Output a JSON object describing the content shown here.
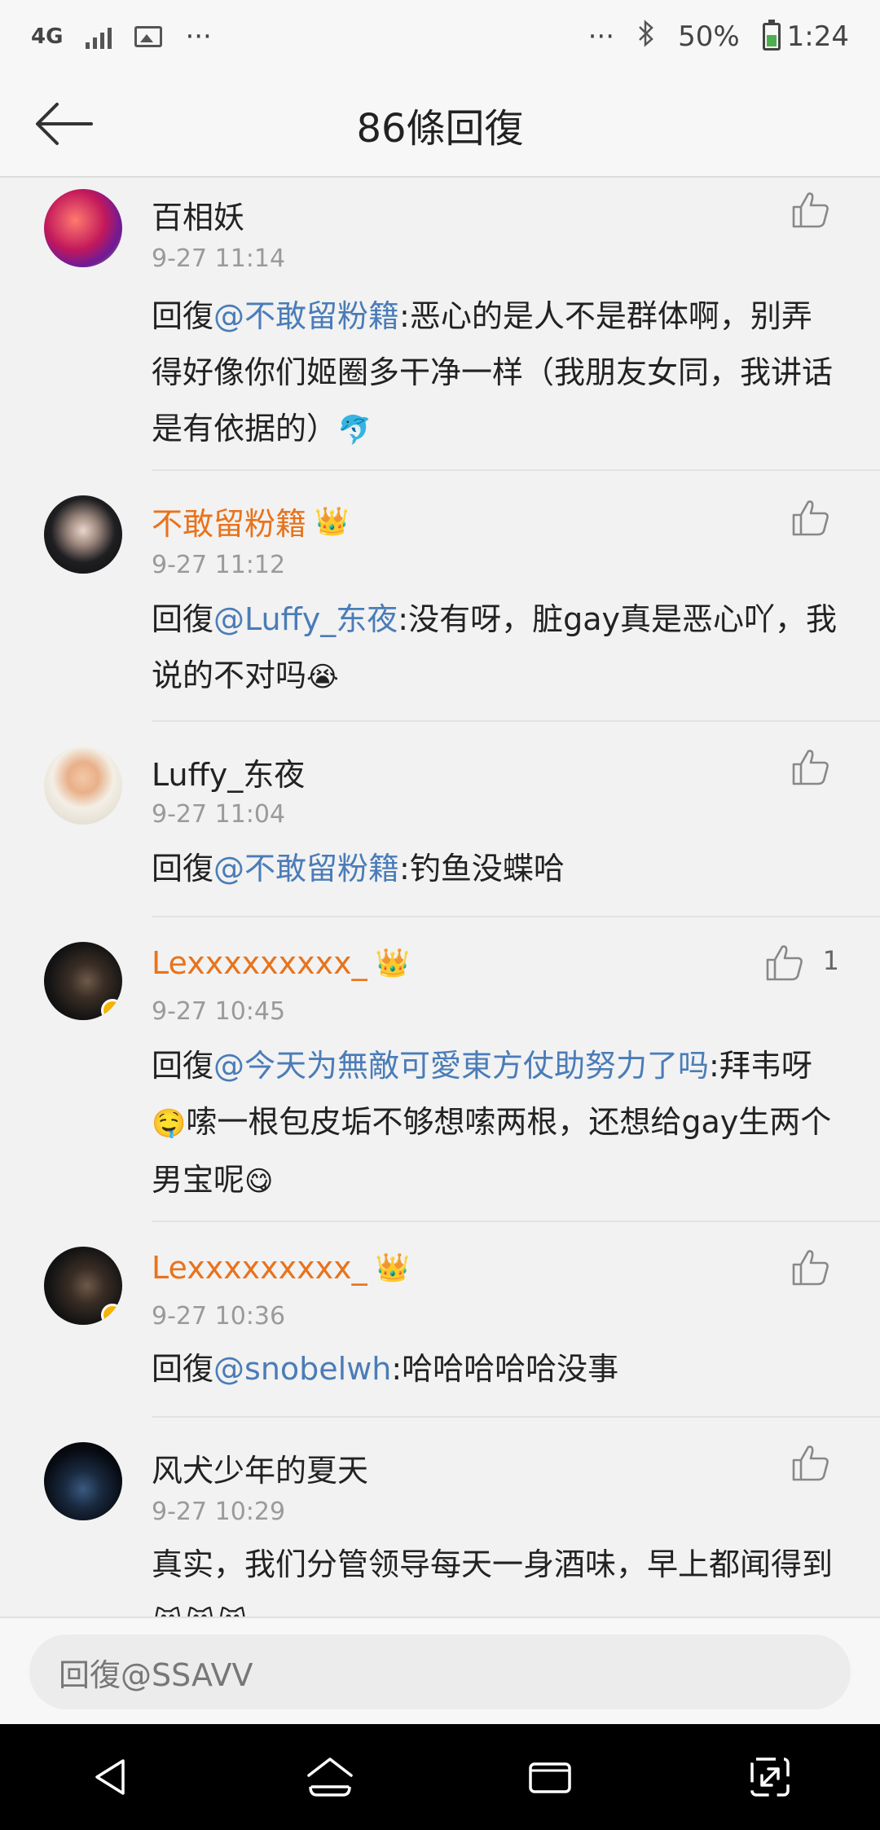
{
  "status_bar": {
    "network": "4G",
    "battery": "50%",
    "time": "1:24",
    "more_left": "···",
    "more_right": "···"
  },
  "header": {
    "title": "86條回復"
  },
  "comments": [
    {
      "name": "百相妖",
      "name_color": "#222222",
      "time": "9-27 11:14",
      "reply_prefix": "回復",
      "mention": "@不敢留粉籍",
      "text": ":恶心的是人不是群体啊，别弄得好像你们姬圈多干净一样（我朋友女同，我讲话是有依据的）",
      "emoji": "🐬"
    },
    {
      "name": "不敢留粉籍",
      "crown": "👑",
      "time": "9-27 11:12",
      "reply_prefix": "回復",
      "mention": "@Luffy_东夜",
      "text": ":没有呀，脏gay真是恶心吖，我说的不对吗",
      "emoji": "😭"
    },
    {
      "name": "Luffy_东夜",
      "time": "9-27 11:04",
      "reply_prefix": "回復",
      "mention": "@不敢留粉籍",
      "text": ":钓鱼没蝶哈"
    },
    {
      "name": "Lexxxxxxxxx_",
      "crown": "👑",
      "time": "9-27 10:45",
      "like_count": "1",
      "reply_prefix": "回復",
      "mention": "@今天为無敵可愛東方仗助努力了吗",
      "text_part1": ":拜韦呀",
      "emoji1": "🤤",
      "text_part2": "嗦一根包皮垢不够想嗦两根，还想给gay生两个男宝呢",
      "emoji2": "😋"
    },
    {
      "name": "Lexxxxxxxxx_",
      "crown": "👑",
      "time": "9-27 10:36",
      "reply_prefix": "回復",
      "mention": "@snobelwh",
      "text": ":哈哈哈哈哈没事"
    },
    {
      "name": "风犬少年的夏天",
      "time": "9-27 10:29",
      "text": "真实，我们分管领导每天一身酒味，早上都闻得到",
      "emoji": "😹😹😹"
    }
  ],
  "reply_bar": {
    "placeholder": "回復@SSAVV"
  }
}
